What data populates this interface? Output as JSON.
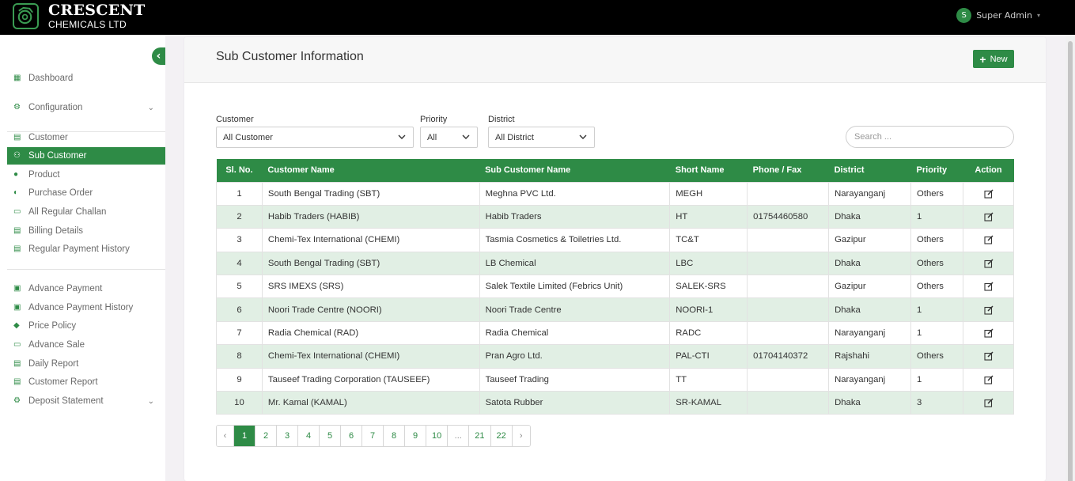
{
  "brand": {
    "line1": "CRESCENT",
    "line2": "CHEMICALS LTD"
  },
  "user": {
    "initial": "S",
    "name": "Super Admin"
  },
  "sidebar": {
    "collapse_icon": "chevron-left-icon",
    "items": [
      {
        "label": "Dashboard",
        "icon": "grid-icon"
      },
      {
        "label": "Configuration",
        "icon": "cogs-icon",
        "expandable": true
      },
      {
        "label": "Customer",
        "icon": "id-card-icon"
      },
      {
        "label": "Sub Customer",
        "icon": "users-icon",
        "active": true
      },
      {
        "label": "Product",
        "icon": "product-icon"
      },
      {
        "label": "Purchase Order",
        "icon": "pie-icon"
      },
      {
        "label": "All Regular Challan",
        "icon": "card-icon"
      },
      {
        "label": "Billing Details",
        "icon": "document-icon"
      },
      {
        "label": "Regular Payment History",
        "icon": "document-icon"
      },
      {
        "label": "Advance Payment",
        "icon": "receipt-icon"
      },
      {
        "label": "Advance Payment History",
        "icon": "receipt-icon"
      },
      {
        "label": "Price Policy",
        "icon": "tags-icon"
      },
      {
        "label": "Advance Sale",
        "icon": "card-icon"
      },
      {
        "label": "Daily Report",
        "icon": "document-icon"
      },
      {
        "label": "Customer Report",
        "icon": "document-icon"
      },
      {
        "label": "Deposit Statement",
        "icon": "cogs-icon",
        "expandable": true
      }
    ]
  },
  "page": {
    "title": "Sub Customer Information",
    "new_button": "New"
  },
  "filters": {
    "customer": {
      "label": "Customer",
      "value": "All Customer"
    },
    "priority": {
      "label": "Priority",
      "value": "All"
    },
    "district": {
      "label": "District",
      "value": "All District"
    },
    "search_placeholder": "Search ..."
  },
  "table": {
    "headers": [
      "Sl. No.",
      "Customer Name",
      "Sub Customer Name",
      "Short Name",
      "Phone / Fax",
      "District",
      "Priority",
      "Action"
    ],
    "rows": [
      [
        "1",
        "South Bengal Trading (SBT)",
        "Meghna PVC Ltd.",
        "MEGH",
        "",
        "Narayanganj",
        "Others"
      ],
      [
        "2",
        "Habib Traders (HABIB)",
        "Habib Traders",
        "HT",
        "01754460580",
        "Dhaka",
        "1"
      ],
      [
        "3",
        "Chemi-Tex International (CHEMI)",
        "Tasmia Cosmetics & Toiletries Ltd.",
        "TC&T",
        "",
        "Gazipur",
        "Others"
      ],
      [
        "4",
        "South Bengal Trading (SBT)",
        "LB Chemical",
        "LBC",
        "",
        "Dhaka",
        "Others"
      ],
      [
        "5",
        "SRS IMEXS (SRS)",
        "Salek Textile Limited (Febrics Unit)",
        "SALEK-SRS",
        "",
        "Gazipur",
        "Others"
      ],
      [
        "6",
        "Noori Trade Centre (NOORI)",
        "Noori Trade Centre",
        "NOORI-1",
        "",
        "Dhaka",
        "1"
      ],
      [
        "7",
        "Radia Chemical (RAD)",
        "Radia Chemical",
        "RADC",
        "",
        "Narayanganj",
        "1"
      ],
      [
        "8",
        "Chemi-Tex International (CHEMI)",
        "Pran Agro Ltd.",
        "PAL-CTI",
        "01704140372",
        "Rajshahi",
        "Others"
      ],
      [
        "9",
        "Tauseef Trading Corporation (TAUSEEF)",
        "Tauseef Trading",
        "TT",
        "",
        "Narayanganj",
        "1"
      ],
      [
        "10",
        "Mr. Kamal (KAMAL)",
        "Satota Rubber",
        "SR-KAMAL",
        "",
        "Dhaka",
        "3"
      ]
    ]
  },
  "pagination": [
    "‹",
    "1",
    "2",
    "3",
    "4",
    "5",
    "6",
    "7",
    "8",
    "9",
    "10",
    "...",
    "21",
    "22",
    "›"
  ],
  "pagination_active": "1",
  "colors": {
    "accent": "#2e8b46",
    "row_alt": "#e1efe4",
    "topbar": "#000000"
  }
}
